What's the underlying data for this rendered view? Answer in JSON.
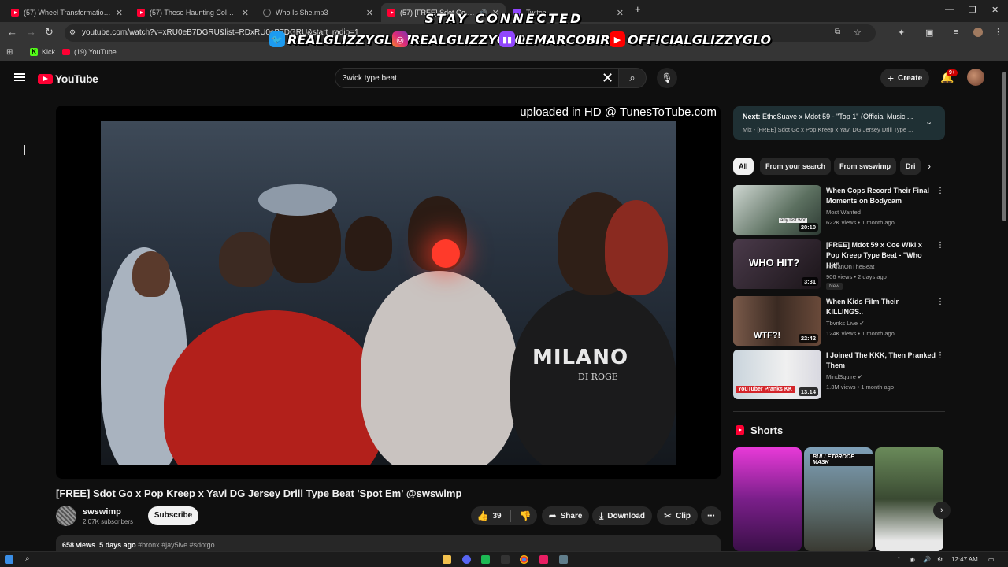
{
  "browser": {
    "tabs": [
      {
        "label": "(57) Wheel Transformation on",
        "favicon": "youtube-icon"
      },
      {
        "label": "(57) These Haunting Cold Case",
        "favicon": "youtube-icon"
      },
      {
        "label": "Who Is She.mp3",
        "favicon": "globe-icon"
      },
      {
        "label": "(57) [FREE] Sdot Go x Pop",
        "favicon": "youtube-icon"
      },
      {
        "label": "Twitch",
        "favicon": "twitch-icon"
      }
    ],
    "url": "youtube.com/watch?v=xRU0eB7DGRU&list=RDxRU0eB7DGRU&start_radio=1",
    "bookmarks": [
      {
        "label": "Kick",
        "icon": "kick-icon"
      },
      {
        "label": "(19) YouTube",
        "icon": "youtube-icon"
      }
    ]
  },
  "overlay": {
    "title": "STAY CONNECTED",
    "socials": [
      {
        "handle": "REALGLIZZYGLO74",
        "icon": "twitter-icon",
        "color": "#1d9bf0"
      },
      {
        "handle": "REALGLIZZYGLO",
        "icon": "instagram-icon",
        "color": "#e1306c"
      },
      {
        "handle": "LEMARCOBIRD",
        "icon": "twitch-icon",
        "color": "#9146ff"
      },
      {
        "handle": "OFFICIALGLIZZYGLO",
        "icon": "youtube-icon",
        "color": "#ff0000"
      }
    ]
  },
  "youtube": {
    "logo": "YouTube",
    "search": {
      "value": "3wick type beat"
    },
    "create_label": "Create",
    "notifications_badge": "9+"
  },
  "player": {
    "overlay_text": "uploaded in HD @ TunesToTube.com",
    "jacket_text_1": "MILANO",
    "jacket_text_2": "DI ROGE"
  },
  "video": {
    "title": "[FREE] Sdot Go x Pop Kreep x Yavi DG Jersey Drill Type Beat 'Spot Em' @swswimp",
    "channel": "swswimp",
    "subscribers": "2.07K subscribers",
    "subscribe_label": "Subscribe",
    "likes": "39",
    "share_label": "Share",
    "download_label": "Download",
    "clip_label": "Clip",
    "views": "658 views",
    "age": "5 days ago",
    "tags": "#bronx #jay5ive #sdotgo"
  },
  "up_next": {
    "prefix": "Next:",
    "title": "EthoSuave x Mdot 59 - \"Top 1\" (Official Music ...",
    "mix": "Mix - [FREE] Sdot Go x Pop Kreep x Yavi DG Jersey Drill Type ..."
  },
  "chips": [
    "All",
    "From your search",
    "From swswimp",
    "Dri"
  ],
  "recommendations": [
    {
      "title": "When Cops Record Their Final Moments on Bodycam",
      "channel": "Most Wanted",
      "verified": false,
      "meta": "622K views • 1 month ago",
      "duration": "20:10",
      "badge": "",
      "thumb_text": "any last wor"
    },
    {
      "title": "[FREE] Mdot 59 x Coe Wiki x Pop Kreep Type Beat - \"Who Hit\"",
      "channel": "JordanOnTheBeat",
      "verified": false,
      "meta": "906 views • 2 days ago",
      "duration": "3:31",
      "badge": "New",
      "thumb_text": "WHO HIT?"
    },
    {
      "title": "When Kids Film Their KILLINGS..",
      "channel": "Tbvnks Live",
      "verified": true,
      "meta": "124K views • 1 month ago",
      "duration": "22:42",
      "badge": "",
      "thumb_text": "WTF?!"
    },
    {
      "title": "I Joined The KKK, Then Pranked Them",
      "channel": "MindSquire",
      "verified": true,
      "meta": "1.3M views • 1 month ago",
      "duration": "13:14",
      "badge": "",
      "thumb_text": "YouTuber Pranks KK"
    }
  ],
  "shorts": {
    "header": "Shorts",
    "items": [
      {
        "caption": ""
      },
      {
        "caption": "BULLETPROOF MASK"
      },
      {
        "caption": ""
      }
    ]
  },
  "taskbar": {
    "time": "12:47 AM"
  }
}
